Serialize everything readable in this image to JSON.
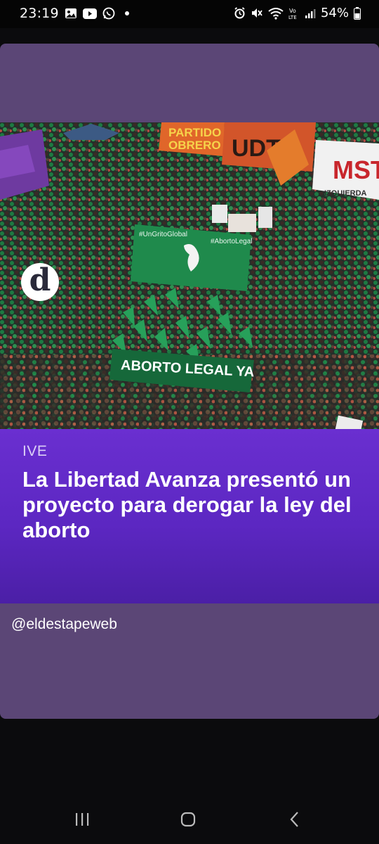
{
  "status_bar": {
    "time": "23:19",
    "battery_percent": "54%",
    "notification_icons": [
      "gallery-icon",
      "youtube-icon",
      "whatsapp-icon"
    ],
    "system_icons": [
      "alarm-icon",
      "mute-icon",
      "wifi-icon",
      "volte-icon",
      "signal-icon",
      "battery-icon"
    ],
    "volte_label": "Vo LTE"
  },
  "post": {
    "background_color": "#5b4676",
    "image": {
      "sign_ml": "MST",
      "banner_top_left": "PARTIDO OBRERO",
      "banner_top_middle": "UDT",
      "banner_right_sub": "IZQUIERDA",
      "banner_green_tag_left": "#UnGritoGlobal",
      "banner_green_tag_right": "#AbortoLegal",
      "banner_main": "ABORTO LEGAL YA",
      "logo_letter": "d"
    },
    "kicker": "IVE",
    "headline": "La Libertad Avanza presentó un proyecto para derogar la ley del aborto",
    "handle": "@eldestapeweb"
  },
  "nav_bar": {
    "buttons": [
      "recent-apps",
      "home",
      "back"
    ]
  },
  "colors": {
    "headline_gradient_top": "#6a2fd0",
    "headline_gradient_bottom": "#4b1fa6",
    "pro_choice_green": "#1f8a4c"
  }
}
